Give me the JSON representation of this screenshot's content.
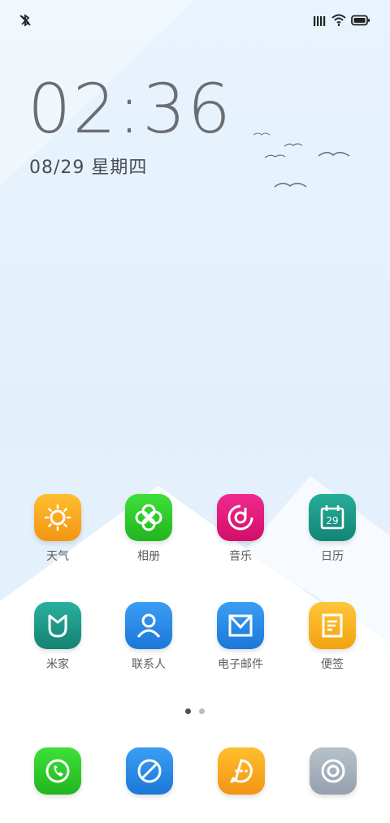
{
  "status_bar": {
    "left_icon": "bluetooth-off-icon",
    "right_icons": [
      "signal-icon",
      "wifi-icon",
      "battery-icon"
    ]
  },
  "clock": {
    "time": "02:36",
    "date": "08/29 星期四"
  },
  "apps": [
    {
      "label": "天气",
      "icon": "weather-sun-icon",
      "color": "#f6a019"
    },
    {
      "label": "相册",
      "icon": "gallery-flower-icon",
      "color": "#2fcc2a"
    },
    {
      "label": "音乐",
      "icon": "music-disc-icon",
      "color": "#e3157a"
    },
    {
      "label": "日历",
      "icon": "calendar-icon",
      "color": "#1c9b89",
      "badge": "29"
    },
    {
      "label": "米家",
      "icon": "mijia-icon",
      "color": "#1f9d8e"
    },
    {
      "label": "联系人",
      "icon": "contacts-icon",
      "color": "#2a8ae8"
    },
    {
      "label": "电子邮件",
      "icon": "mail-icon",
      "color": "#2a8ae8"
    },
    {
      "label": "便签",
      "icon": "notes-icon",
      "color": "#f6b317"
    }
  ],
  "page_indicator": {
    "pages": 2,
    "current": 1
  },
  "dock": [
    {
      "icon": "phone-icon",
      "color": "#2fcc2a"
    },
    {
      "icon": "browser-icon",
      "color": "#2a8ae8"
    },
    {
      "icon": "messages-icon",
      "color": "#f6a019"
    },
    {
      "icon": "camera-icon",
      "color": "#a7b3bd"
    }
  ]
}
